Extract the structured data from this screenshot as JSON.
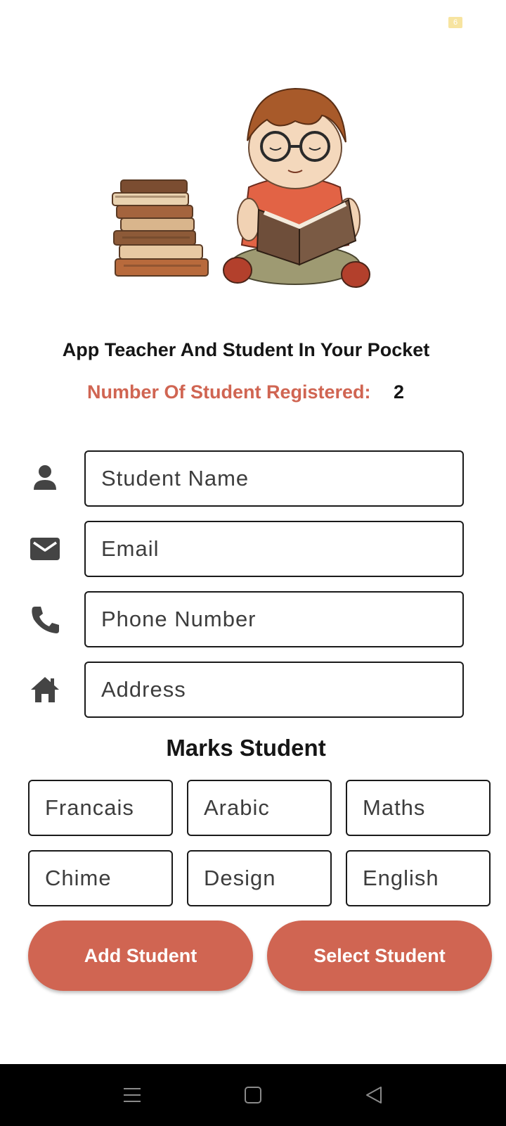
{
  "status_bar": {
    "badge_text": "6"
  },
  "header": {
    "title": "App Teacher And Student In Your Pocket",
    "count_label": "Number Of Student Registered:",
    "count_value": "2"
  },
  "illustration": {
    "semantic": "boy-reading-book-with-stack-of-books"
  },
  "form": {
    "fields": [
      {
        "icon": "person-icon",
        "placeholder": "Student Name",
        "value": ""
      },
      {
        "icon": "mail-icon",
        "placeholder": "Email",
        "value": ""
      },
      {
        "icon": "phone-icon",
        "placeholder": "Phone Number",
        "value": ""
      },
      {
        "icon": "home-icon",
        "placeholder": "Address",
        "value": ""
      }
    ]
  },
  "marks": {
    "title": "Marks Student",
    "subjects": [
      {
        "placeholder": "Francais"
      },
      {
        "placeholder": "Arabic"
      },
      {
        "placeholder": "Maths"
      },
      {
        "placeholder": "Chime"
      },
      {
        "placeholder": "Design"
      },
      {
        "placeholder": "English"
      }
    ]
  },
  "actions": {
    "add_label": "Add Student",
    "select_label": "Select Student"
  },
  "nav": {
    "items": [
      "menu-icon",
      "home-square-icon",
      "back-icon"
    ]
  },
  "colors": {
    "accent": "#d06552",
    "text": "#151515",
    "nav_background": "#000000"
  }
}
